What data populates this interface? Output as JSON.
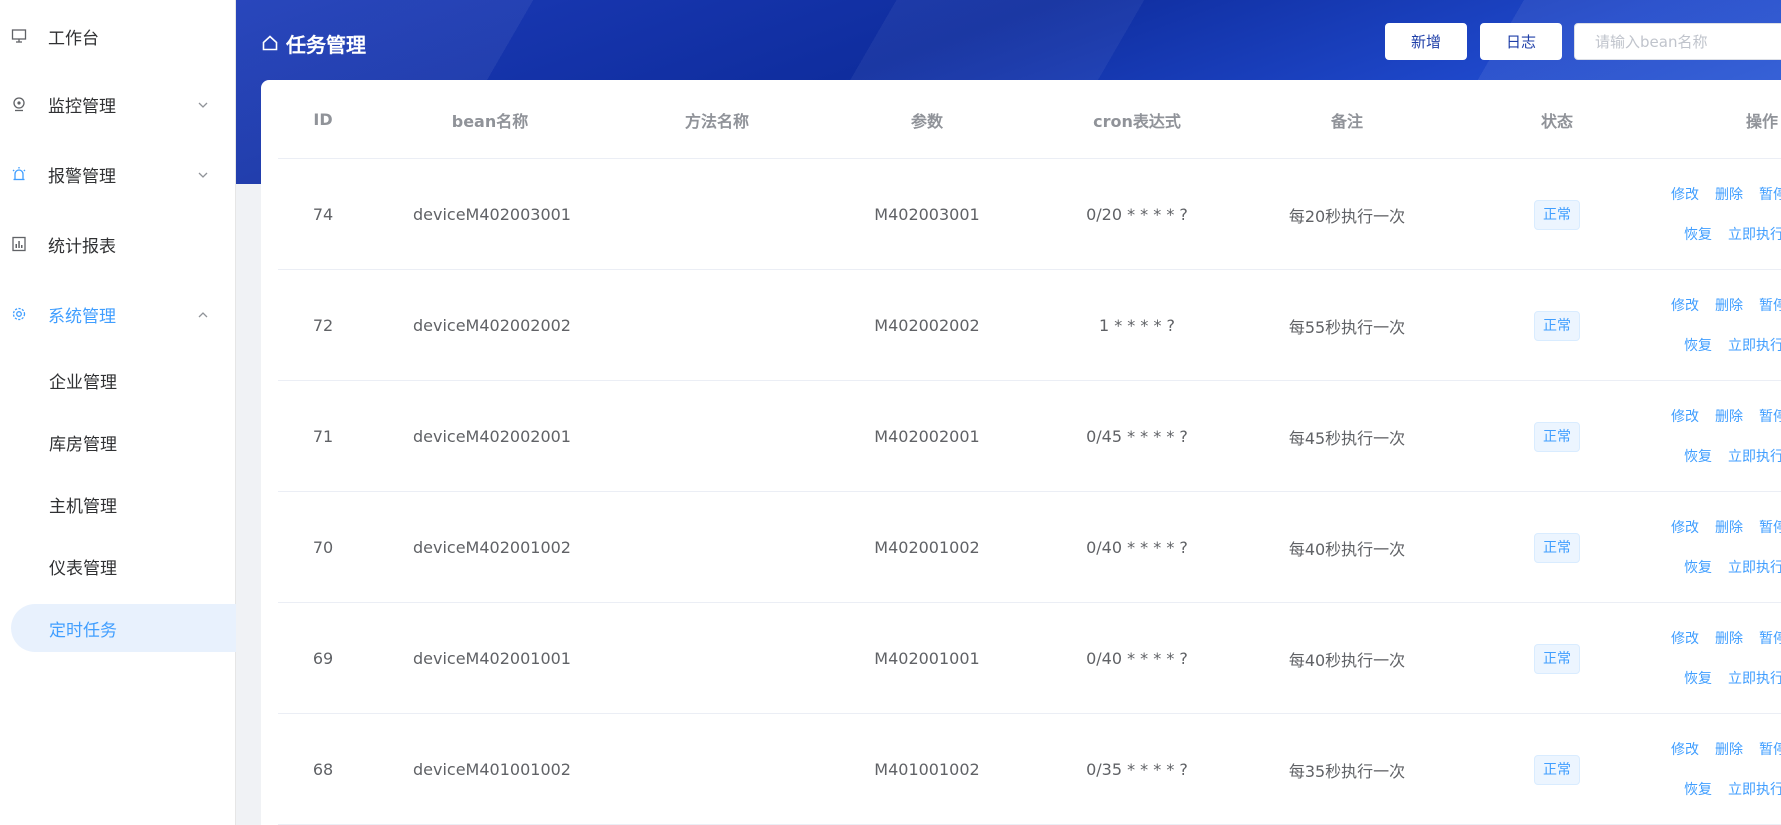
{
  "sidebar": {
    "items": [
      {
        "label": "工作台",
        "icon": "monitor-icon"
      },
      {
        "label": "监控管理",
        "icon": "camera-icon"
      },
      {
        "label": "报警管理",
        "icon": "alarm-icon"
      },
      {
        "label": "统计报表",
        "icon": "chart-report-icon"
      },
      {
        "label": "系统管理",
        "icon": "gear-icon"
      }
    ],
    "sub_items": [
      {
        "label": "企业管理"
      },
      {
        "label": "库房管理"
      },
      {
        "label": "主机管理"
      },
      {
        "label": "仪表管理"
      },
      {
        "label": "定时任务"
      }
    ]
  },
  "header": {
    "title": "任务管理",
    "add_label": "新增",
    "log_label": "日志",
    "search_placeholder": "请输入bean名称",
    "search_value": ""
  },
  "table": {
    "columns": [
      "ID",
      "bean名称",
      "方法名称",
      "参数",
      "cron表达式",
      "备注",
      "状态",
      "操作"
    ],
    "actions": {
      "edit": "修改",
      "delete": "删除",
      "pause": "暂停",
      "resume": "恢复",
      "run": "立即执行"
    },
    "rows": [
      {
        "id": "74",
        "bean": "deviceM402003001",
        "method": "",
        "param": "M402003001",
        "cron": "0/20 * * * * ?",
        "remark": "每20秒执行一次",
        "status": "正常"
      },
      {
        "id": "72",
        "bean": "deviceM402002002",
        "method": "",
        "param": "M402002002",
        "cron": "1 * * * * ?",
        "remark": "每55秒执行一次",
        "status": "正常"
      },
      {
        "id": "71",
        "bean": "deviceM402002001",
        "method": "",
        "param": "M402002001",
        "cron": "0/45 * * * * ?",
        "remark": "每45秒执行一次",
        "status": "正常"
      },
      {
        "id": "70",
        "bean": "deviceM402001002",
        "method": "",
        "param": "M402001002",
        "cron": "0/40 * * * * ?",
        "remark": "每40秒执行一次",
        "status": "正常"
      },
      {
        "id": "69",
        "bean": "deviceM402001001",
        "method": "",
        "param": "M402001001",
        "cron": "0/40 * * * * ?",
        "remark": "每40秒执行一次",
        "status": "正常"
      },
      {
        "id": "68",
        "bean": "deviceM401001002",
        "method": "",
        "param": "M401001002",
        "cron": "0/35 * * * * ?",
        "remark": "每35秒执行一次",
        "status": "正常"
      }
    ]
  },
  "colors": {
    "accent": "#409eff",
    "header_bg": "#0f2d9e",
    "active_bg": "#e8f1fd"
  }
}
